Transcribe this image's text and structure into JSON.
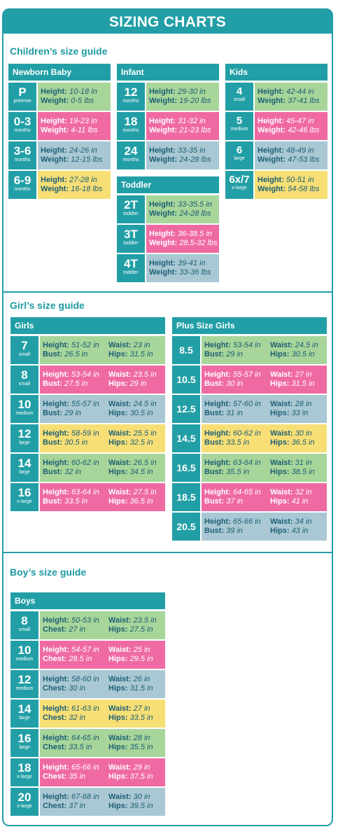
{
  "banner": "SIZING CHARTS",
  "children": {
    "title": "Children’s size guide",
    "newborn": {
      "header": "Newborn Baby",
      "rows": [
        {
          "size": "P",
          "sub": "preemie",
          "height": "10-18 in",
          "weight": "0-5 lbs",
          "color": "green"
        },
        {
          "size": "0-3",
          "sub": "months",
          "height": "19-23 in",
          "weight": "4-11 lbs",
          "color": "pink"
        },
        {
          "size": "3-6",
          "sub": "months",
          "height": "24-26 in",
          "weight": "12-15 lbs",
          "color": "blue"
        },
        {
          "size": "6-9",
          "sub": "months",
          "height": "27-28 in",
          "weight": "16-18 lbs",
          "color": "yellow"
        }
      ]
    },
    "infant": {
      "header": "Infant",
      "rows": [
        {
          "size": "12",
          "sub": "months",
          "height": "29-30 in",
          "weight": "19-20 lbs",
          "color": "green"
        },
        {
          "size": "18",
          "sub": "months",
          "height": "31-32 in",
          "weight": "21-23 lbs",
          "color": "pink"
        },
        {
          "size": "24",
          "sub": "months",
          "height": "33-35 in",
          "weight": "24-28 lbs",
          "color": "blue"
        }
      ]
    },
    "toddler": {
      "header": "Toddler",
      "rows": [
        {
          "size": "2T",
          "sub": "toddler",
          "height": "33-35.5 in",
          "weight": "24-28 lbs",
          "color": "green"
        },
        {
          "size": "3T",
          "sub": "toddler",
          "height": "36-38.5 in",
          "weight": "28.5-32 lbs",
          "color": "pink"
        },
        {
          "size": "4T",
          "sub": "toddler",
          "height": "39-41 in",
          "weight": "33-36 lbs",
          "color": "blue"
        }
      ]
    },
    "kids": {
      "header": "Kids",
      "rows": [
        {
          "size": "4",
          "sub": "small",
          "height": "42-44 in",
          "weight": "37-41 lbs",
          "color": "green"
        },
        {
          "size": "5",
          "sub": "medium",
          "height": "45-47 in",
          "weight": "42-46 lbs",
          "color": "pink"
        },
        {
          "size": "6",
          "sub": "large",
          "height": "48-49 in",
          "weight": "47-53 lbs",
          "color": "blue"
        },
        {
          "size": "6x/7",
          "sub": "x-large",
          "height": "50-51 in",
          "weight": "54-58 lbs",
          "color": "yellow"
        }
      ]
    }
  },
  "girls_section": {
    "title": "Girl’s size guide",
    "girls": {
      "header": "Girls",
      "rows": [
        {
          "size": "7",
          "sub": "small",
          "height": "51-52 in",
          "waist": "23 in",
          "bust": "26.5 in",
          "hips": "31.5 in",
          "color": "green"
        },
        {
          "size": "8",
          "sub": "small",
          "height": "53-54 in",
          "waist": "23.5 in",
          "bust": "27.5 in",
          "hips": "29 in",
          "color": "pink"
        },
        {
          "size": "10",
          "sub": "medium",
          "height": "55-57 in",
          "waist": "24.5 in",
          "bust": "29 in",
          "hips": "30.5 in",
          "color": "blue"
        },
        {
          "size": "12",
          "sub": "large",
          "height": "58-59 in",
          "waist": "25.5 in",
          "bust": "30.5 in",
          "hips": "32.5 in",
          "color": "yellow"
        },
        {
          "size": "14",
          "sub": "large",
          "height": "60-62 in",
          "waist": "26.5 in",
          "bust": "32 in",
          "hips": "34.5 in",
          "color": "green"
        },
        {
          "size": "16",
          "sub": "x-large",
          "height": "63-64 in",
          "waist": "27.5 in",
          "bust": "33.5 in",
          "hips": "36.5 in",
          "color": "pink"
        }
      ]
    },
    "plus": {
      "header": "Plus Size Girls",
      "rows": [
        {
          "size": "8.5",
          "height": "53-54 in",
          "waist": "24.5 in",
          "bust": "29 in",
          "hips": "30.5 in",
          "color": "green"
        },
        {
          "size": "10.5",
          "height": "55-57 in",
          "waist": "27 in",
          "bust": "30 in",
          "hips": "31.5 in",
          "color": "pink"
        },
        {
          "size": "12.5",
          "height": "57-60 in",
          "waist": "28 in",
          "bust": "31 in",
          "hips": "33 in",
          "color": "blue"
        },
        {
          "size": "14.5",
          "height": "60-62 in",
          "waist": "30 in",
          "bust": "33.5 in",
          "hips": "36.5 in",
          "color": "yellow"
        },
        {
          "size": "16.5",
          "height": "63-64 in",
          "waist": "31 in",
          "bust": "35.5 in",
          "hips": "38.5 in",
          "color": "green"
        },
        {
          "size": "18.5",
          "height": "64-65 in",
          "waist": "32 in",
          "bust": "37 in",
          "hips": "41 in",
          "color": "pink"
        },
        {
          "size": "20.5",
          "height": "65-66 in",
          "waist": "34 in",
          "bust": "39 in",
          "hips": "43 in",
          "color": "blue"
        }
      ]
    }
  },
  "boys_section": {
    "title": "Boy’s size guide",
    "boys": {
      "header": "Boys",
      "rows": [
        {
          "size": "8",
          "sub": "small",
          "height": "50-53 in",
          "waist": "23.5 in",
          "chest": "27 in",
          "hips": "27.5 in",
          "color": "green"
        },
        {
          "size": "10",
          "sub": "medium",
          "height": "54-57 in",
          "waist": "25 in",
          "chest": "28.5 in",
          "hips": "29.5 in",
          "color": "pink"
        },
        {
          "size": "12",
          "sub": "medium",
          "height": "58-60 in",
          "waist": "26 in",
          "chest": "30 in",
          "hips": "31.5 in",
          "color": "blue"
        },
        {
          "size": "14",
          "sub": "large",
          "height": "61-63 in",
          "waist": "27 in",
          "chest": "32 in",
          "hips": "33.5 in",
          "color": "yellow"
        },
        {
          "size": "16",
          "sub": "large",
          "height": "64-65 in",
          "waist": "28 in",
          "chest": "33.5 in",
          "hips": "35.5 in",
          "color": "green"
        },
        {
          "size": "18",
          "sub": "x-large",
          "height": "65-66 in",
          "waist": "29 in",
          "chest": "35 in",
          "hips": "37.5 in",
          "color": "pink"
        },
        {
          "size": "20",
          "sub": "x-large",
          "height": "67-68 in",
          "waist": "30 in",
          "chest": "37 in",
          "hips": "39.5 in",
          "color": "blue"
        }
      ]
    }
  },
  "labels": {
    "height": "Height:",
    "weight": "Weight:",
    "waist": "Waist:",
    "bust": "Bust:",
    "hips": "Hips:",
    "chest": "Chest:"
  },
  "colors": {
    "teal": "#229fa6",
    "green": "#a7d59a",
    "pink": "#ef6aa2",
    "blue": "#a9c8d4",
    "yellow": "#f7df76"
  }
}
